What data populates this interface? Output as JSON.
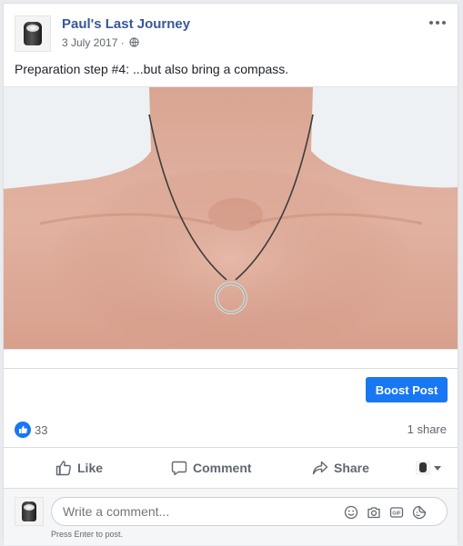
{
  "post": {
    "page_name": "Paul's Last Journey",
    "date": "3 July 2017 ·",
    "text": "Preparation step #4: ...but also bring a compass."
  },
  "boost": {
    "label": "Boost Post"
  },
  "stats": {
    "like_count": "33",
    "shares": "1 share"
  },
  "actions": {
    "like": "Like",
    "comment": "Comment",
    "share": "Share"
  },
  "comment_box": {
    "placeholder": "Write a comment...",
    "hint": "Press Enter to post."
  },
  "colors": {
    "brand": "#1877f2",
    "link": "#365899",
    "muted": "#606770"
  },
  "icons": [
    "globe-icon",
    "more-icon",
    "like-icon",
    "comment-icon",
    "share-icon",
    "emoji-icon",
    "camera-icon",
    "gif-icon",
    "sticker-icon"
  ]
}
